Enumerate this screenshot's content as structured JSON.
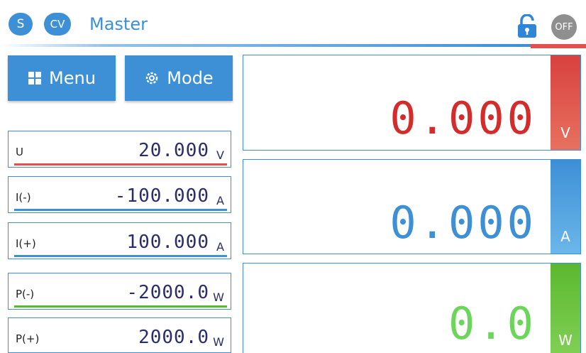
{
  "header": {
    "badge_s": "S",
    "badge_cv": "CV",
    "title": "Master",
    "lock_icon": "unlock-icon",
    "power_status": "OFF"
  },
  "buttons": {
    "menu_label": "Menu",
    "menu_icon": "grid-icon",
    "mode_label": "Mode",
    "mode_icon": "gear-icon"
  },
  "params": [
    {
      "label": "U",
      "value": "20.000",
      "unit": "V",
      "color": "#e25050"
    },
    {
      "label": "I(-)",
      "value": "-100.000",
      "unit": "A",
      "color": "#3d8fd6"
    },
    {
      "label": "I(+)",
      "value": "100.000",
      "unit": "A",
      "color": "#3d8fd6"
    },
    {
      "label": "P(-)",
      "value": "-2000.0",
      "unit": "W",
      "color": "#5cb82f"
    },
    {
      "label": "P(+)",
      "value": "2000.0",
      "unit": "W",
      "color": "#5cb82f"
    }
  ],
  "readouts": {
    "voltage": {
      "value": "0.000",
      "unit": "V",
      "color": "#d42b2b",
      "side_color": "#e25050"
    },
    "current": {
      "value": "0.000",
      "unit": "A",
      "color": "#3d8fd6",
      "side_color": "#4ea3e0"
    },
    "power": {
      "value": "0.0",
      "unit": "W",
      "color": "#6cd65a",
      "side_color": "#5cb82f"
    }
  },
  "colors": {
    "accent": "#3d8fd6",
    "voltage": "#e25050",
    "current": "#3d8fd6",
    "power": "#5cb82f"
  }
}
